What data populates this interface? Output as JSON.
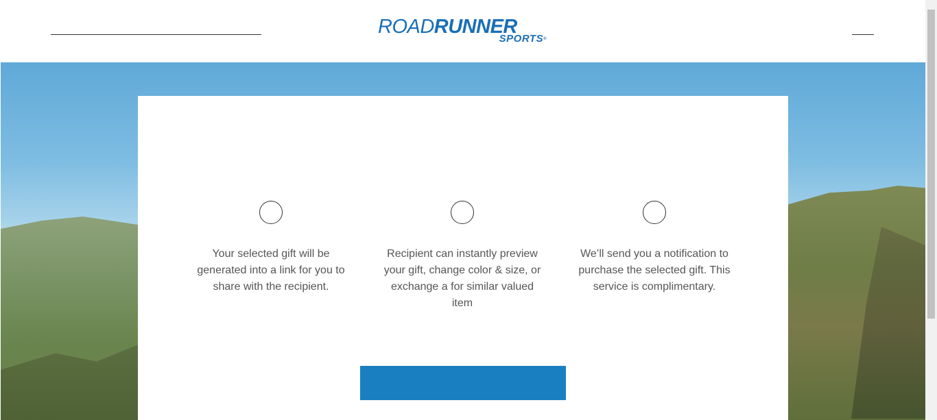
{
  "header": {
    "logo_top_regular": "ROAD",
    "logo_top_bold": "RUNNER",
    "logo_bottom": "SPORTS",
    "logo_reg_mark": "®"
  },
  "steps": [
    {
      "text": "Your selected gift will be generated into a link for you to share with the recipient."
    },
    {
      "text": "Recipient can instantly preview your gift, change color & size, or exchange a for similar valued item"
    },
    {
      "text": "We’ll send you a notification to purchase the selected gift. This service is complimentary."
    }
  ],
  "cta": {
    "label": ""
  },
  "colors": {
    "brand_blue": "#1a6fb6",
    "button_blue": "#1a7fc1"
  }
}
